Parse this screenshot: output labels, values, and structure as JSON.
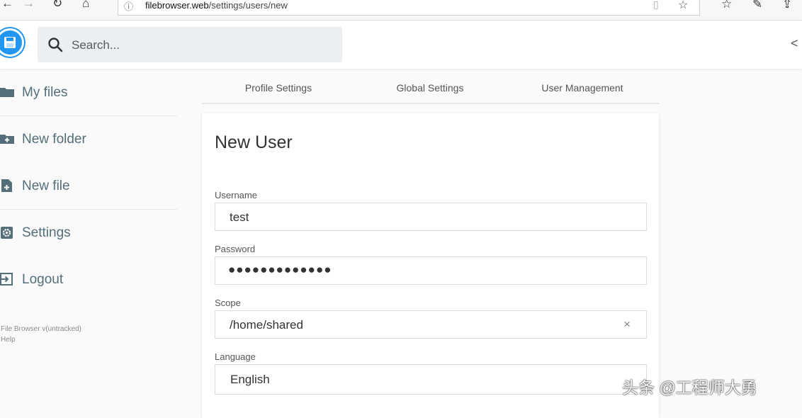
{
  "browser": {
    "url_domain": "filebrowser.web",
    "url_path": "/settings/users/new",
    "info_glyph": "ⓘ"
  },
  "header": {
    "search_placeholder": "Search..."
  },
  "sidebar": {
    "items": [
      {
        "label": "My files",
        "icon": "folder-icon"
      },
      {
        "label": "New folder",
        "icon": "folder-plus-icon"
      },
      {
        "label": "New file",
        "icon": "file-plus-icon"
      },
      {
        "label": "Settings",
        "icon": "gear-icon"
      },
      {
        "label": "Logout",
        "icon": "logout-icon"
      }
    ],
    "credits": [
      "File Browser v(untracked)",
      "Help"
    ]
  },
  "tabs": [
    {
      "label": "Profile Settings"
    },
    {
      "label": "Global Settings"
    },
    {
      "label": "User Management"
    }
  ],
  "form": {
    "title": "New User",
    "username_label": "Username",
    "username_value": "test",
    "password_label": "Password",
    "password_masked": "●●●●●●●●●●●●●",
    "scope_label": "Scope",
    "scope_value": "/home/shared",
    "scope_clear": "×",
    "language_label": "Language",
    "language_value": "English"
  },
  "watermark": "头条 @工程师大勇",
  "colors": {
    "accent": "#2196f3",
    "sidebar_text": "#546e7a"
  }
}
